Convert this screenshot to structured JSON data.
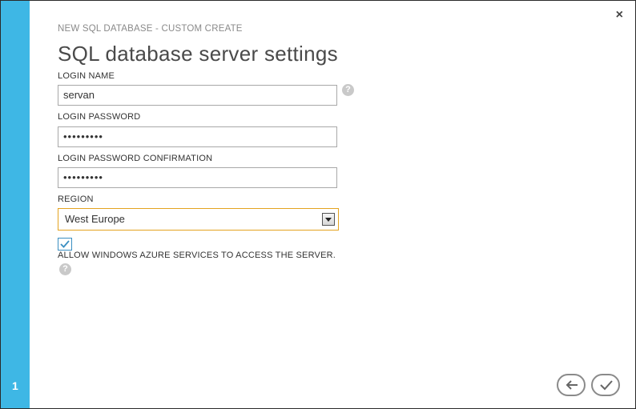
{
  "wizard": {
    "subtitle": "NEW SQL DATABASE - CUSTOM CREATE",
    "title": "SQL database server settings",
    "step_number": "1",
    "close_glyph": "×"
  },
  "form": {
    "login_name": {
      "label": "LOGIN NAME",
      "value": "servan"
    },
    "login_password": {
      "label": "LOGIN PASSWORD",
      "value": "•••••••••"
    },
    "login_password_confirmation": {
      "label": "LOGIN PASSWORD CONFIRMATION",
      "value": "•••••••••"
    },
    "region": {
      "label": "REGION",
      "value": "West Europe"
    },
    "allow_azure_services": {
      "checked": true,
      "label": "ALLOW WINDOWS AZURE SERVICES TO ACCESS THE SERVER."
    }
  },
  "help_glyph": "?",
  "icons": {
    "close": "close-icon",
    "help": "help-icon",
    "check": "check-icon",
    "back": "back-arrow-icon",
    "complete": "checkmark-icon"
  },
  "colors": {
    "step_bar": "#3eb7e5",
    "select_border": "#e4a320",
    "checkbox_border": "#3b8fc2"
  }
}
